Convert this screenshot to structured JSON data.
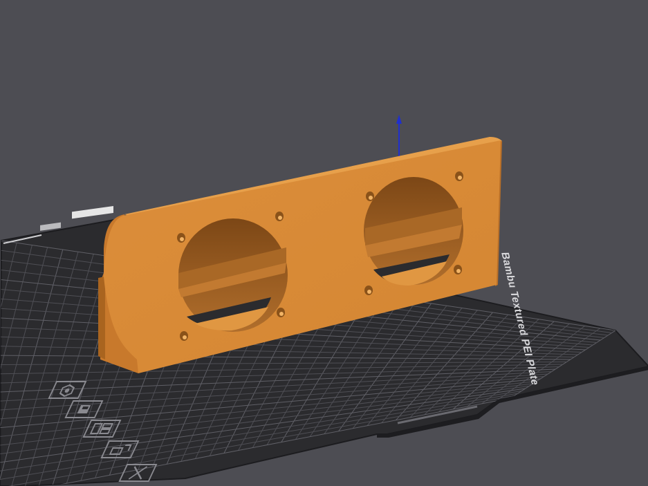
{
  "viewport": {
    "background_color": "#4d4d53",
    "plate": {
      "label": "Bambu Textured PEI Plate",
      "surface_color": "#2b2b2e",
      "grid_color": "#4f4f55",
      "edge_color": "#1c1c1f"
    },
    "model": {
      "color_front": "#d98b38",
      "color_top": "#e79a46",
      "color_side": "#c67a2d",
      "color_inner": "#8a5219"
    },
    "axis": {
      "z_color": "#1f2fd0"
    },
    "plate_stamp_icons": [
      {
        "name": "auto-orient-icon"
      },
      {
        "name": "plate-settings-icon"
      },
      {
        "name": "arrange-icon"
      },
      {
        "name": "lock-plate-icon"
      },
      {
        "name": "delete-plate-icon"
      }
    ]
  }
}
